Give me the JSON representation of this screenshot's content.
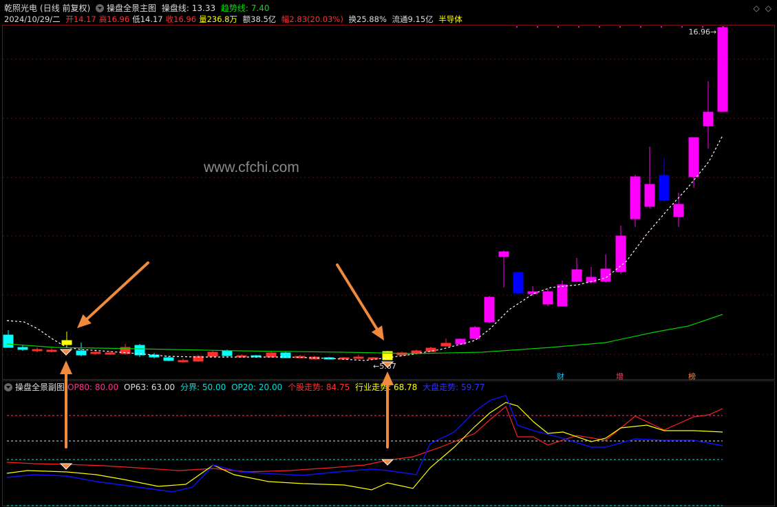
{
  "header": {
    "stock_name": "乾照光电",
    "period": "(日线 前复权)",
    "main_chart_name": "操盘全景主图",
    "line1_label": "操盘线: 13.33",
    "line2_label": "趋势线: 7.40"
  },
  "info": {
    "date": "2024/10/29/二",
    "open": "开14.17",
    "high": "高16.96",
    "low": "低14.17",
    "close": "收16.96",
    "volume": "量236.8万",
    "amount": "额38.5亿",
    "change": "幅2.83(20.03%)",
    "turnover": "换25.88%",
    "float": "流通9.15亿",
    "sector": "半导体"
  },
  "main_chart": {
    "price_high_label": "16.96",
    "price_low_label": "5.67",
    "event_badges": [
      "财",
      "增",
      "榜"
    ]
  },
  "sub_chart": {
    "name": "操盘全景副图",
    "op80": "OP80: 80.00",
    "op63": "OP63: 63.00",
    "divider": "分界: 50.00",
    "op20": "OP20: 20.00",
    "stock_trend": "个股走势: 84.75",
    "industry_trend": "行业走势: 68.78",
    "market_trend": "大盘走势: 59.77"
  },
  "watermark": "www.cfchi.com",
  "colors": {
    "up": "#ff3030",
    "down": "#00ffff",
    "strong_up": "#ff00ff",
    "strong_down": "#0000ff",
    "yellow": "#ffff00",
    "ma_line": "#00d000",
    "arrow": "#f08a3c"
  },
  "icons": [
    "collapse-triangle-icon",
    "diamond-icon"
  ]
}
